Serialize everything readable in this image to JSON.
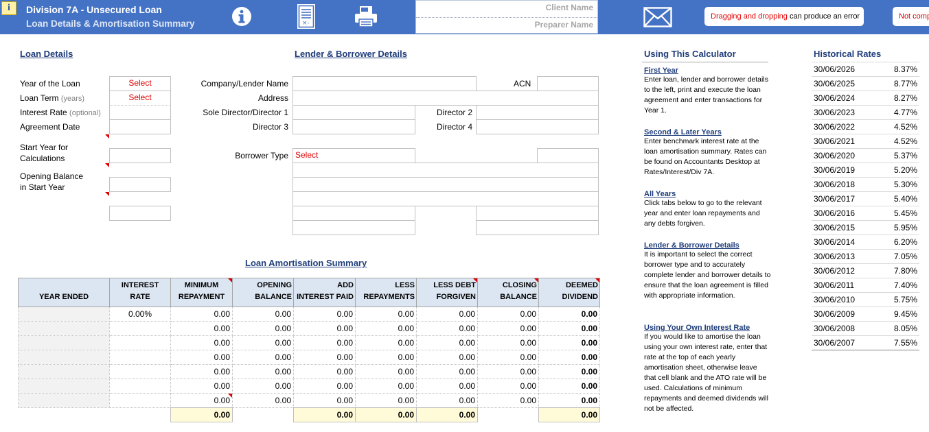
{
  "header": {
    "info_badge": "i",
    "title": "Division 7A - Unsecured Loan",
    "subtitle": "Loan Details & Amortisation Summary",
    "icons": [
      "info-icon",
      "calculator-sheet-icon",
      "printer-icon",
      "email-icon"
    ],
    "client_name_placeholder": "Client Name",
    "preparer_name_placeholder": "Preparer Name",
    "warning": {
      "red_part": "Dragging and dropping",
      "rest": " can produce an error"
    },
    "warning2": "Not comp",
    "brand_color": "#4472c4"
  },
  "loan_details": {
    "title": "Loan Details",
    "year_label": "Year of the Loan",
    "year_value": "Select",
    "term_label": "Loan Term",
    "term_unit": "(years)",
    "term_value": "Select",
    "rate_label": "Interest Rate",
    "rate_note": "(optional)",
    "agreement_label": "Agreement Date",
    "start_year_label_1": "Start Year for",
    "start_year_label_2": "Calculations",
    "opening_label_1": "Opening Balance",
    "opening_label_2": "in Start Year"
  },
  "lender": {
    "title": "Lender & Borrower Details",
    "company_label": "Company/Lender Name",
    "acn_label": "ACN",
    "address_label": "Address",
    "director1_label": "Sole Director/Director 1",
    "director2_label": "Director 2",
    "director3_label": "Director 3",
    "director4_label": "Director 4",
    "borrower_type_label": "Borrower Type",
    "borrower_type_value": "Select"
  },
  "amortisation": {
    "title": "Loan Amortisation Summary",
    "headers": [
      [
        "YEAR ENDED"
      ],
      [
        "INTEREST",
        "RATE"
      ],
      [
        "MINIMUM",
        "REPAYMENT"
      ],
      [
        "OPENING",
        "BALANCE"
      ],
      [
        "ADD",
        "INTEREST PAID"
      ],
      [
        "LESS",
        "REPAYMENTS"
      ],
      [
        "LESS DEBT",
        "FORGIVEN"
      ],
      [
        "CLOSING",
        "BALANCE"
      ],
      [
        "DEEMED",
        "DIVIDEND"
      ]
    ],
    "first_rate": "0.00%",
    "rows": [
      [
        "0.00",
        "0.00",
        "0.00",
        "0.00",
        "0.00",
        "0.00",
        "0.00"
      ],
      [
        "0.00",
        "0.00",
        "0.00",
        "0.00",
        "0.00",
        "0.00",
        "0.00"
      ],
      [
        "0.00",
        "0.00",
        "0.00",
        "0.00",
        "0.00",
        "0.00",
        "0.00"
      ],
      [
        "0.00",
        "0.00",
        "0.00",
        "0.00",
        "0.00",
        "0.00",
        "0.00"
      ],
      [
        "0.00",
        "0.00",
        "0.00",
        "0.00",
        "0.00",
        "0.00",
        "0.00"
      ],
      [
        "0.00",
        "0.00",
        "0.00",
        "0.00",
        "0.00",
        "0.00",
        "0.00"
      ],
      [
        "0.00",
        "0.00",
        "0.00",
        "0.00",
        "0.00",
        "0.00",
        "0.00"
      ]
    ],
    "totals": {
      "min_repayment": "0.00",
      "interest": "0.00",
      "repayments": "0.00",
      "forgiven": "0.00",
      "dividend": "0.00"
    }
  },
  "using": {
    "title": "Using This Calculator",
    "sections": [
      {
        "head": "First Year",
        "text": "Enter loan, lender and borrower details to the left, print and execute the loan agreement and enter transactions for Year 1."
      },
      {
        "head": "Second & Later Years",
        "text": "Enter benchmark interest rate at the loan amortisation summary.  Rates can be found on Accountants Desktop at Rates/Interest/Div 7A."
      },
      {
        "head": "All Years",
        "text": "Click tabs below to go to the relevant year and enter loan repayments and any debts forgiven."
      },
      {
        "head": "Lender & Borrower Details",
        "text": "It is important to select the correct borrower type and to accurately complete lender and borrower details to ensure that the loan agreement is filled with appropriate information."
      },
      {
        "head": "Using Your Own Interest Rate",
        "text": "If you would like to amortise the loan using your own interest rate, enter that rate at the top of each yearly amortisation sheet, otherwise leave that cell blank and the ATO rate will be used. Calculations of minimum repayments and deemed dividends will not be affected."
      }
    ]
  },
  "historical": {
    "title": "Historical Rates",
    "rows": [
      [
        "30/06/2026",
        "8.37%"
      ],
      [
        "30/06/2025",
        "8.77%"
      ],
      [
        "30/06/2024",
        "8.27%"
      ],
      [
        "30/06/2023",
        "4.77%"
      ],
      [
        "30/06/2022",
        "4.52%"
      ],
      [
        "30/06/2021",
        "4.52%"
      ],
      [
        "30/06/2020",
        "5.37%"
      ],
      [
        "30/06/2019",
        "5.20%"
      ],
      [
        "30/06/2018",
        "5.30%"
      ],
      [
        "30/06/2017",
        "5.40%"
      ],
      [
        "30/06/2016",
        "5.45%"
      ],
      [
        "30/06/2015",
        "5.95%"
      ],
      [
        "30/06/2014",
        "6.20%"
      ],
      [
        "30/06/2013",
        "7.05%"
      ],
      [
        "30/06/2012",
        "7.80%"
      ],
      [
        "30/06/2011",
        "7.40%"
      ],
      [
        "30/06/2010",
        "5.75%"
      ],
      [
        "30/06/2009",
        "9.45%"
      ],
      [
        "30/06/2008",
        "8.05%"
      ],
      [
        "30/06/2007",
        "7.55%"
      ]
    ]
  }
}
